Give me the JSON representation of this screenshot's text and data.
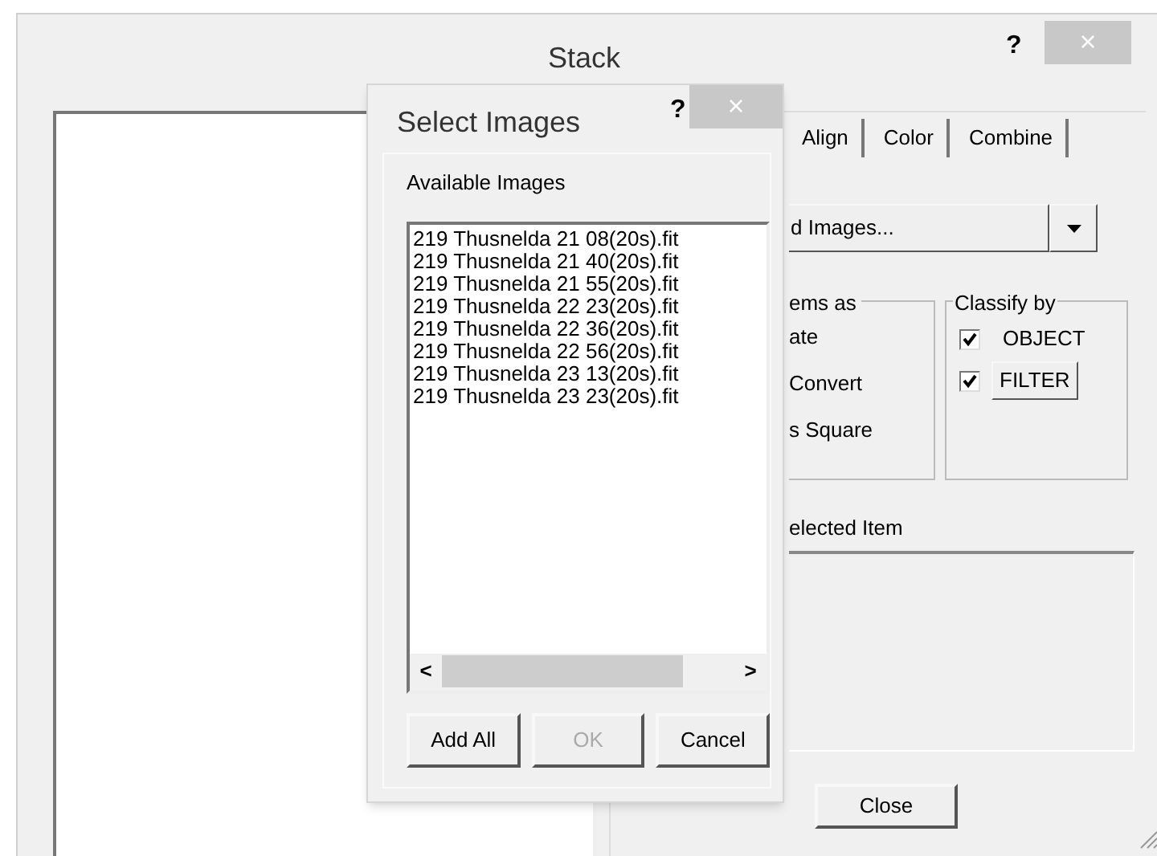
{
  "stack_window": {
    "title": "Stack",
    "help": "?",
    "close": "×",
    "tabs": [
      {
        "label": "Align",
        "selected": false
      },
      {
        "label": "Color",
        "selected": false
      },
      {
        "label": "Combine",
        "selected": false
      }
    ],
    "add_images_button": "d Images...",
    "group_1": {
      "title": "ems as",
      "options": [
        "ate",
        "Convert",
        "s Square"
      ]
    },
    "classify": {
      "title": "Classify by",
      "items": [
        {
          "label": "OBJECT",
          "checked": true,
          "kind": "text"
        },
        {
          "label": "FILTER",
          "checked": true,
          "kind": "button"
        }
      ]
    },
    "selected_item_label": "elected Item",
    "close_button": "Close"
  },
  "select_images": {
    "title": "Select Images",
    "help": "?",
    "close": "×",
    "label": "Available Images",
    "items": [
      "219 Thusnelda 21 08(20s).fit",
      "219 Thusnelda 21 40(20s).fit",
      "219 Thusnelda 21 55(20s).fit",
      "219 Thusnelda 22 23(20s).fit",
      "219 Thusnelda 22 36(20s).fit",
      "219 Thusnelda 22 56(20s).fit",
      "219 Thusnelda 23 13(20s).fit",
      "219 Thusnelda 23 23(20s).fit"
    ],
    "scroll_left": "<",
    "scroll_right": ">",
    "buttons": [
      {
        "label": "Add All",
        "disabled": false
      },
      {
        "label": "OK",
        "disabled": true
      },
      {
        "label": "Cancel",
        "disabled": false
      }
    ]
  }
}
